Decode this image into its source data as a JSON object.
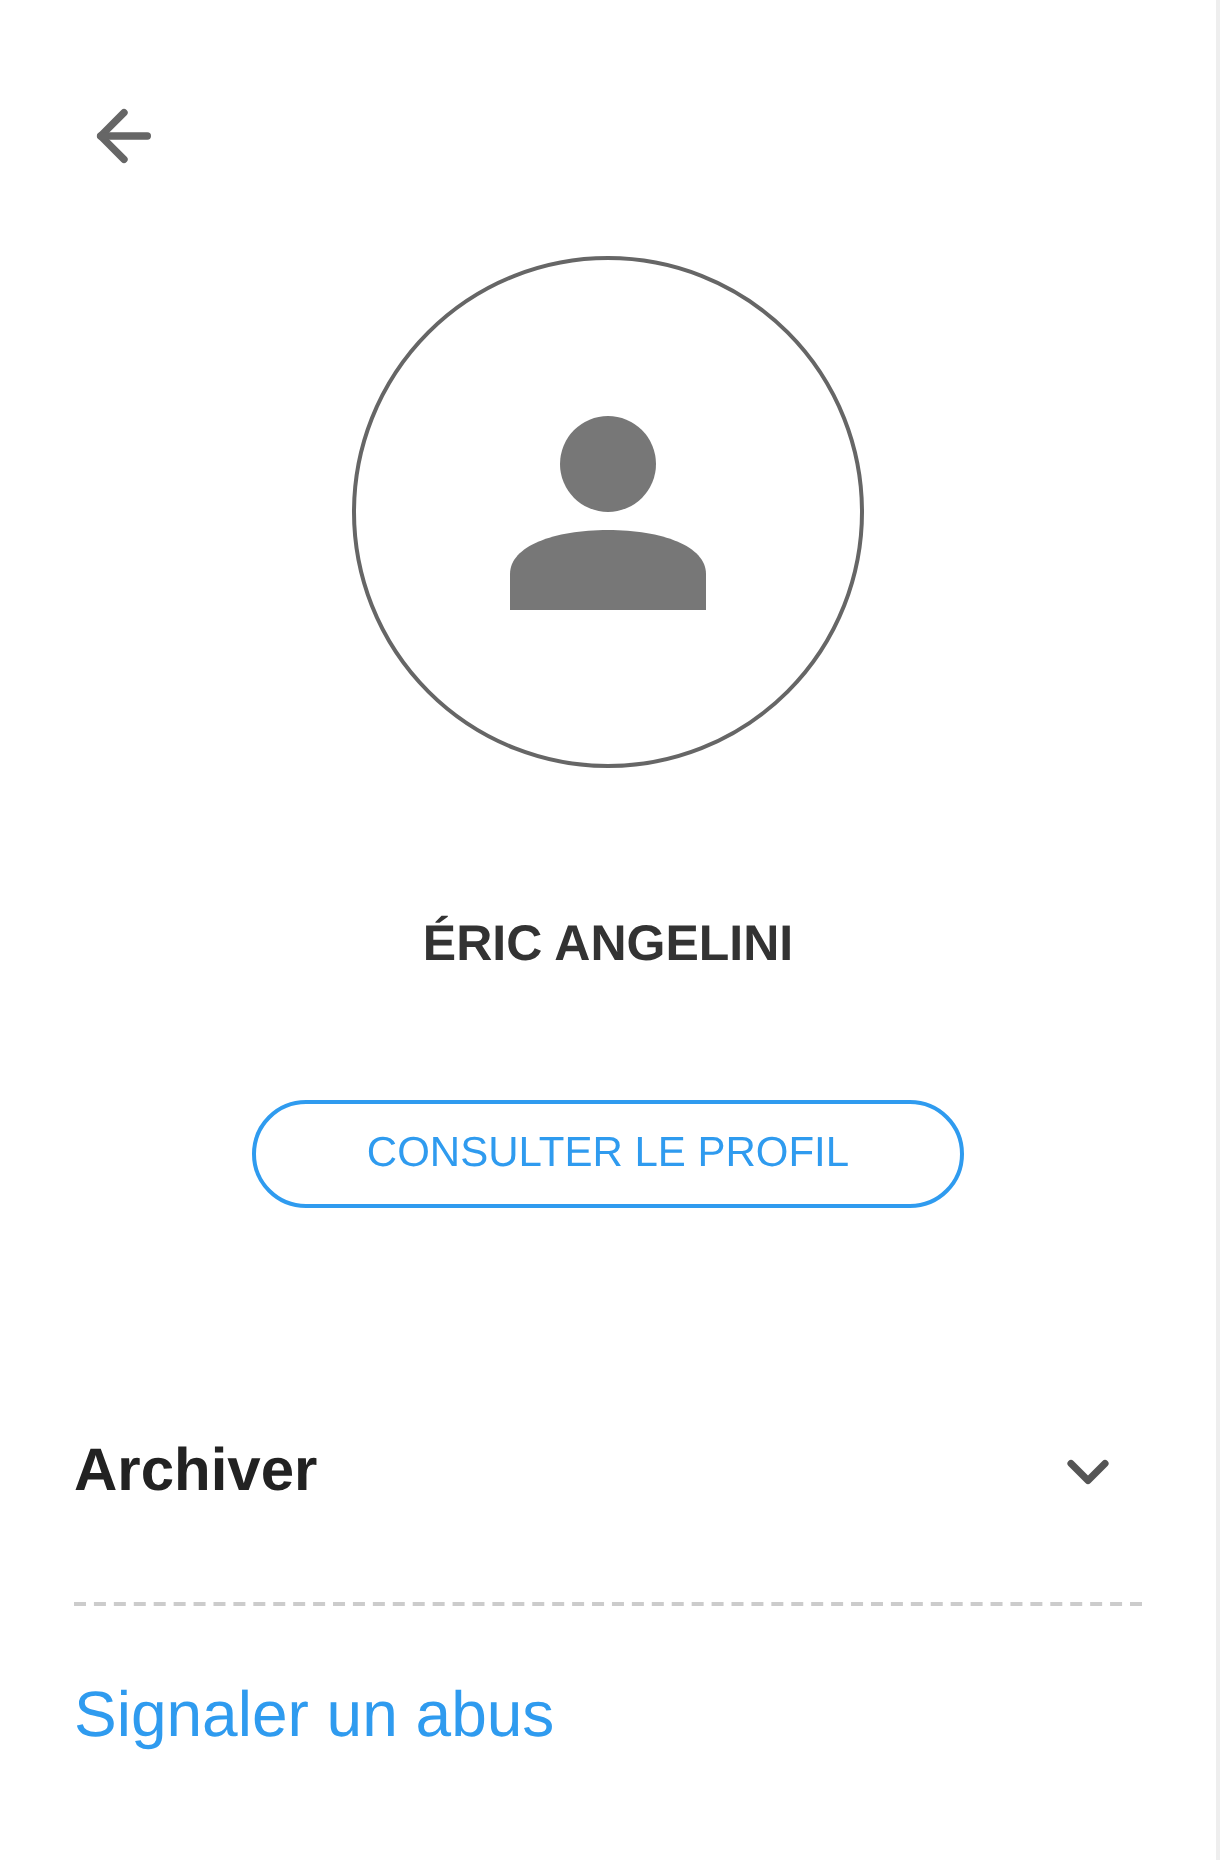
{
  "contact": {
    "name": "ÉRIC ANGELINI"
  },
  "profile_button": {
    "label": "CONSULTER LE PROFIL"
  },
  "sections": [
    {
      "label": "Archiver",
      "expanded": false
    }
  ],
  "report_link": {
    "label": "Signaler un abus"
  }
}
